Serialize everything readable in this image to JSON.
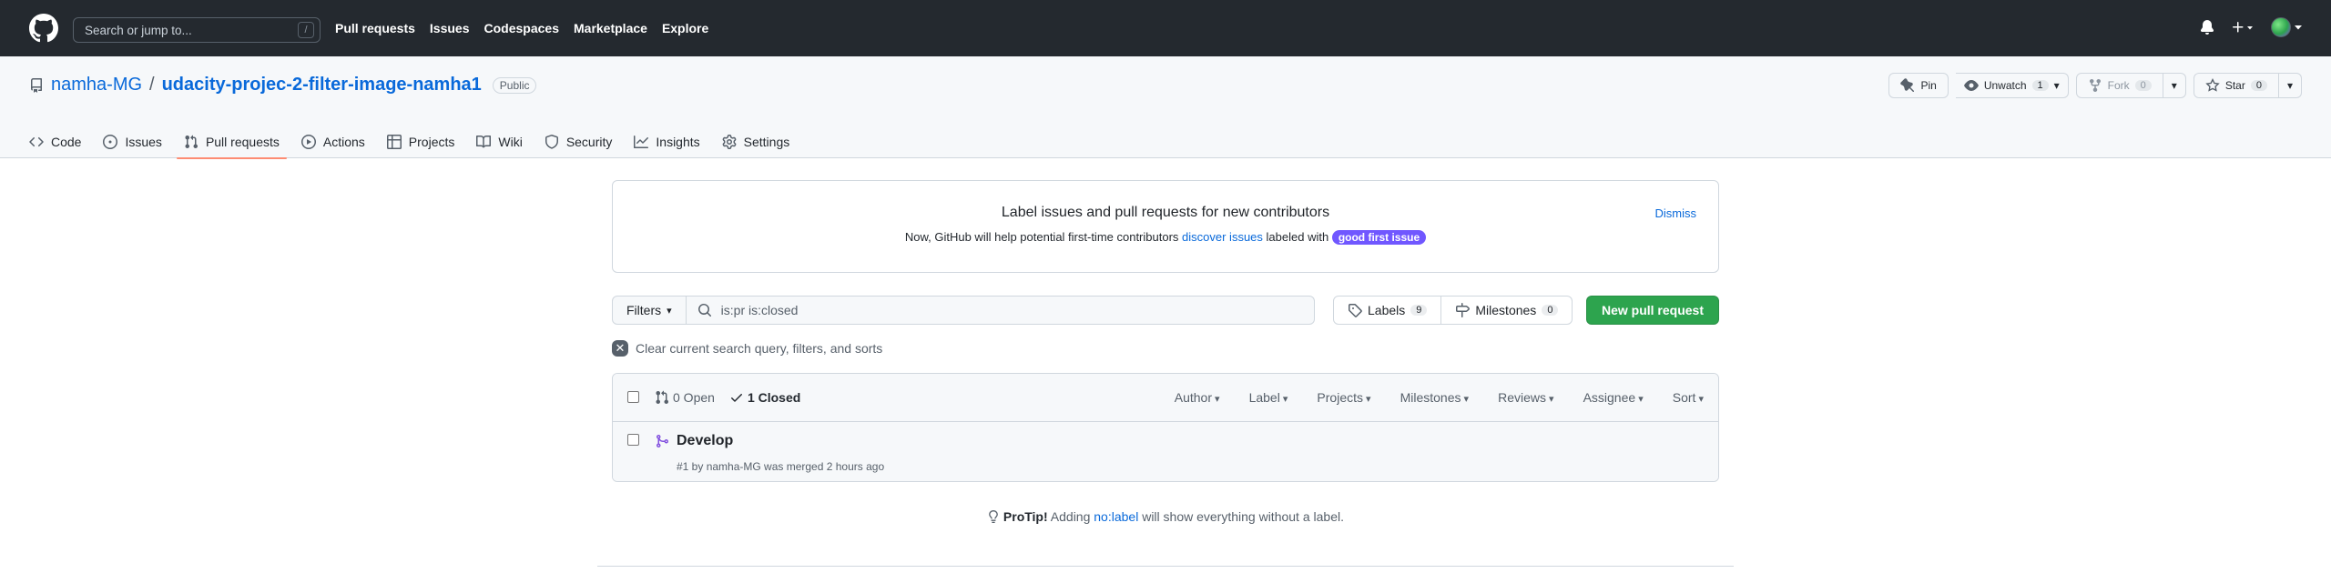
{
  "header": {
    "search_placeholder": "Search or jump to...",
    "search_key": "/",
    "nav": [
      "Pull requests",
      "Issues",
      "Codespaces",
      "Marketplace",
      "Explore"
    ]
  },
  "repo": {
    "owner": "namha-MG",
    "separator": "/",
    "name": "udacity-projec-2-filter-image-namha1",
    "visibility": "Public",
    "pin_label": "Pin",
    "watch_label": "Unwatch",
    "watch_count": "1",
    "fork_label": "Fork",
    "fork_count": "0",
    "star_label": "Star",
    "star_count": "0",
    "tabs": [
      "Code",
      "Issues",
      "Pull requests",
      "Actions",
      "Projects",
      "Wiki",
      "Security",
      "Insights",
      "Settings"
    ]
  },
  "banner": {
    "title": "Label issues and pull requests for new contributors",
    "text_before": "Now, GitHub will help potential first-time contributors",
    "link": "discover issues",
    "text_after": "labeled with",
    "label": "good first issue",
    "label_color": "#7057ff",
    "dismiss": "Dismiss"
  },
  "toolbar": {
    "filters": "Filters",
    "query": "is:pr is:closed",
    "labels": "Labels",
    "labels_count": "9",
    "milestones": "Milestones",
    "milestones_count": "0",
    "new_pr": "New pull request",
    "accent": "#2da44e"
  },
  "clear_text": "Clear current search query, filters, and sorts",
  "list": {
    "open": "0 Open",
    "closed": "1 Closed",
    "sorts": [
      "Author",
      "Label",
      "Projects",
      "Milestones",
      "Reviews",
      "Assignee",
      "Sort"
    ],
    "items": [
      {
        "title": "Develop",
        "meta": "#1 by namha-MG was merged 2 hours ago",
        "state_color": "#8250df"
      }
    ]
  },
  "protip": {
    "lead": "ProTip!",
    "before": "Adding",
    "link": "no:label",
    "after": "will show everything without a label."
  }
}
